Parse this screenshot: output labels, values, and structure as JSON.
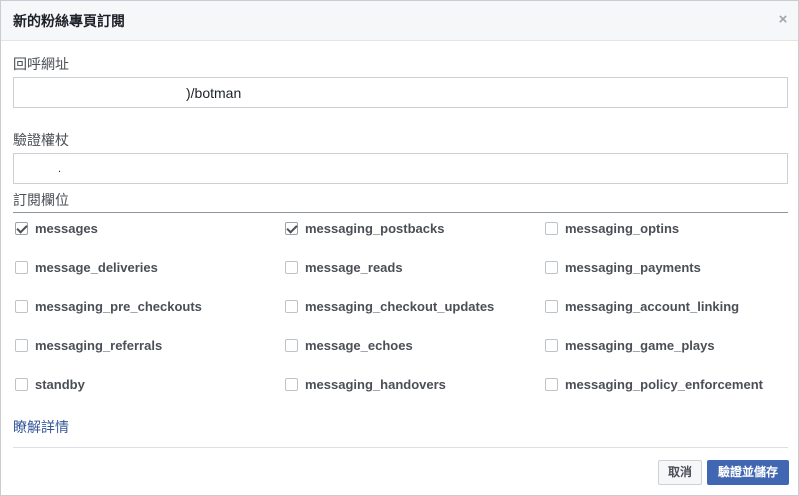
{
  "dialog": {
    "title": "新的粉絲專頁訂閱",
    "close_symbol": "×"
  },
  "callback": {
    "label": "回呼網址",
    "value": ")/botman"
  },
  "verify_token": {
    "label": "驗證權杖",
    "value": "."
  },
  "subscriptions": {
    "label": "訂閱欄位",
    "fields": [
      {
        "name": "messages",
        "checked": true
      },
      {
        "name": "messaging_postbacks",
        "checked": true
      },
      {
        "name": "messaging_optins",
        "checked": false
      },
      {
        "name": "message_deliveries",
        "checked": false
      },
      {
        "name": "message_reads",
        "checked": false
      },
      {
        "name": "messaging_payments",
        "checked": false
      },
      {
        "name": "messaging_pre_checkouts",
        "checked": false
      },
      {
        "name": "messaging_checkout_updates",
        "checked": false
      },
      {
        "name": "messaging_account_linking",
        "checked": false
      },
      {
        "name": "messaging_referrals",
        "checked": false
      },
      {
        "name": "message_echoes",
        "checked": false
      },
      {
        "name": "messaging_game_plays",
        "checked": false
      },
      {
        "name": "standby",
        "checked": false
      },
      {
        "name": "messaging_handovers",
        "checked": false
      },
      {
        "name": "messaging_policy_enforcement",
        "checked": false
      }
    ]
  },
  "learn_more": "瞭解詳情",
  "footer": {
    "cancel_label": "取消",
    "submit_label": "驗證並儲存"
  },
  "colors": {
    "primary_button": "#4267b2",
    "link": "#365899"
  }
}
